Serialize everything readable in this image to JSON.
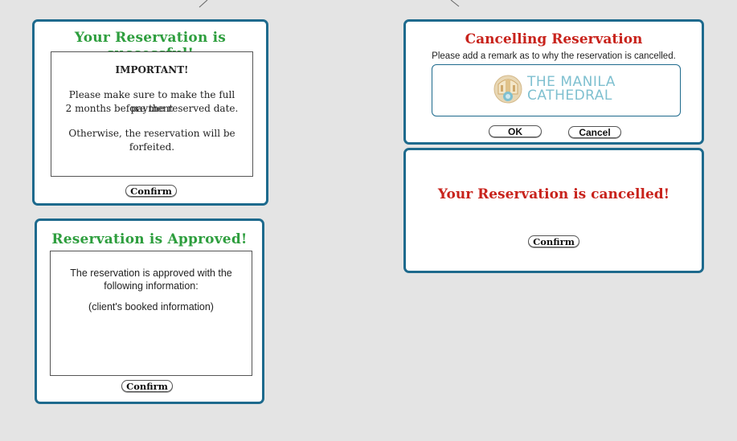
{
  "dialogs": {
    "successful": {
      "title": "Your Reservation is successful!",
      "heading": "IMPORTANT!",
      "line1": "Please make sure to make the full payment",
      "line2": "2 months before the reserved date.",
      "line3": "Otherwise, the reservation will be forfeited.",
      "confirm_label": "Confirm"
    },
    "approved": {
      "title": "Reservation is Approved!",
      "line1": "The reservation is approved with the",
      "line2": "following information:",
      "line3": "(client's booked information)",
      "confirm_label": "Confirm"
    },
    "cancelling": {
      "title": "Cancelling Reservation",
      "subtitle": "Please add a remark as to why the reservation is cancelled.",
      "logo_line1": "THE MANILA",
      "logo_line2": "CATHEDRAL",
      "ok_label": "OK",
      "cancel_label": "Cancel"
    },
    "cancelled": {
      "title": "Your Reservation is cancelled!",
      "confirm_label": "Confirm"
    }
  },
  "colors": {
    "dialog_border": "#1e6a8d",
    "title_green": "#2e9e3e",
    "title_red": "#c8231c",
    "logo_teal": "#7fc0d0"
  }
}
